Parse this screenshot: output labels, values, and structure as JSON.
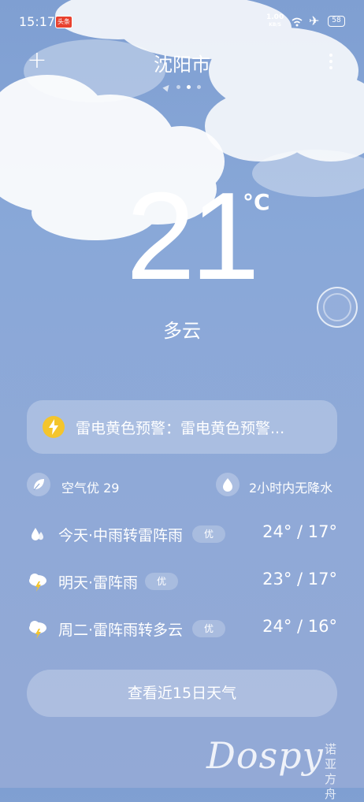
{
  "status_bar": {
    "time": "15:17",
    "app_icon_text": "头条",
    "net_speed_value": "1.00",
    "net_speed_unit": "KB/S",
    "battery": "58"
  },
  "header": {
    "add_label": "+",
    "city": "沈阳市",
    "page_count": 4,
    "active_page": 2
  },
  "current": {
    "temperature": "21",
    "unit": "°C",
    "condition": "多云"
  },
  "alert": {
    "text": "雷电黄色预警：雷电黄色预警..."
  },
  "info": {
    "air_quality": "空气优 29",
    "rain": "2小时内无降水"
  },
  "forecast": [
    {
      "label": "今天·中雨转雷阵雨",
      "badge": "优",
      "temp": "24° / 17°",
      "icon": "rain-drop-icon"
    },
    {
      "label": "明天·雷阵雨",
      "badge": "优",
      "temp": "23° / 17°",
      "icon": "thunderstorm-icon"
    },
    {
      "label": "周二·雷阵雨转多云",
      "badge": "优",
      "temp": "24° / 16°",
      "icon": "thunderstorm-icon"
    }
  ],
  "more_days_button": "查看近15日天气",
  "watermark": {
    "text": "Dospy",
    "cn": "诺亚方舟"
  },
  "colors": {
    "background": "#89a8d8",
    "alert_icon": "#f4c52c"
  }
}
